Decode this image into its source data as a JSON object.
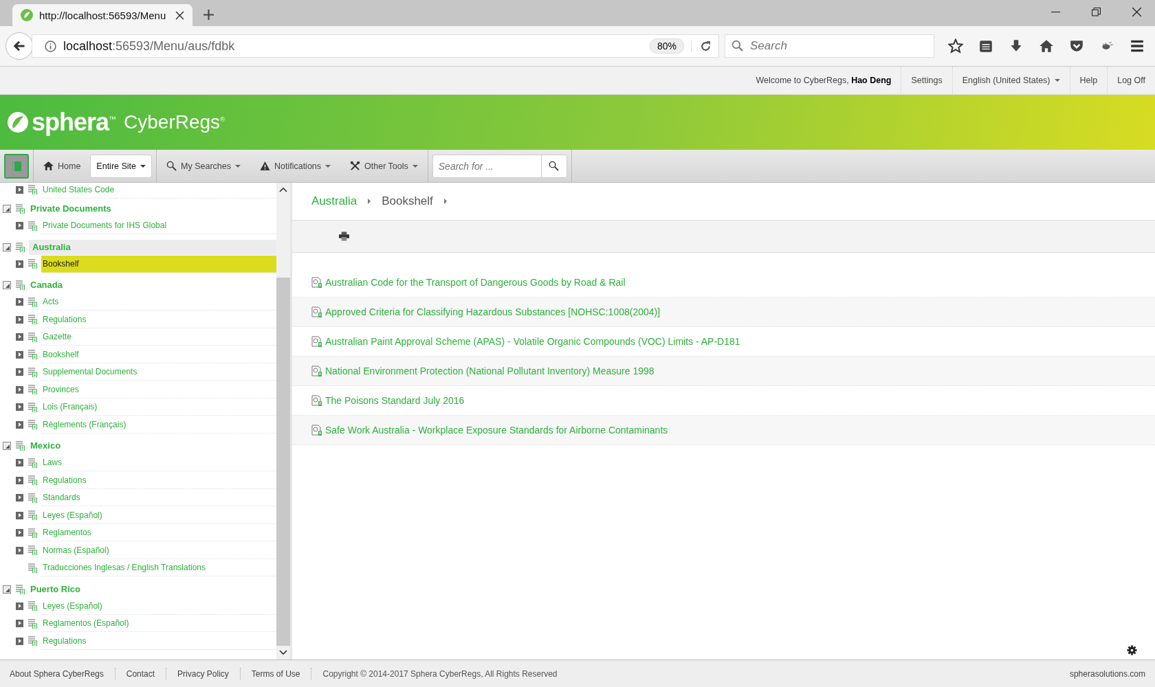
{
  "browser": {
    "tab_title": "http://localhost:56593/Menu",
    "url_host": "localhost",
    "url_path": ":56593/Menu/aus/fdbk",
    "zoom": "80%",
    "search_placeholder": "Search"
  },
  "top_bar": {
    "welcome": "Welcome to CyberRegs, **Hao Deng**",
    "links": [
      {
        "label": "Settings",
        "kind": "link"
      },
      {
        "label": "English (United States)",
        "kind": "dropdown"
      },
      {
        "label": "Help",
        "kind": "link"
      },
      {
        "label": "Log Off",
        "kind": "link"
      }
    ]
  },
  "banner": {
    "brand": "sphera$^{™}$",
    "product": "CyberRegs$^{®}$"
  },
  "toolbar": {
    "items": [
      {
        "label": "Home",
        "kind": "home"
      },
      {
        "label": "Entire Site",
        "kind": "scope"
      },
      {
        "label": "My Searches",
        "kind": "searches"
      },
      {
        "label": "Notifications",
        "kind": "notifications"
      },
      {
        "label": "Other Tools",
        "kind": "tools"
      }
    ],
    "search_placeholder": "Search for ..."
  },
  "tree": {
    "leading_items": [
      {
        "label": "United States Code",
        "expandable": true,
        "selected": false
      }
    ],
    "groups": [
      {
        "label": "Private Documents",
        "expanded": true,
        "selected": false,
        "children": [
          {
            "label": "Private Documents for IHS Global",
            "expandable": true,
            "selected": false
          }
        ]
      },
      {
        "label": "Australia",
        "expanded": true,
        "selected": true,
        "children": [
          {
            "label": "Bookshelf",
            "expandable": true,
            "selected": true
          }
        ]
      },
      {
        "label": "Canada",
        "expanded": true,
        "selected": false,
        "children": [
          {
            "label": "Acts",
            "expandable": true,
            "selected": false
          },
          {
            "label": "Regulations",
            "expandable": true,
            "selected": false
          },
          {
            "label": "Gazette",
            "expandable": true,
            "selected": false
          },
          {
            "label": "Bookshelf",
            "expandable": true,
            "selected": false
          },
          {
            "label": "Supplemental Documents",
            "expandable": true,
            "selected": false
          },
          {
            "label": "Provinces",
            "expandable": true,
            "selected": false
          },
          {
            "label": "Lois (Français)",
            "expandable": true,
            "selected": false
          },
          {
            "label": "Règlements (Français)",
            "expandable": true,
            "selected": false
          }
        ]
      },
      {
        "label": "Mexico",
        "expanded": true,
        "selected": false,
        "children": [
          {
            "label": "Laws",
            "expandable": true,
            "selected": false
          },
          {
            "label": "Regulations",
            "expandable": true,
            "selected": false
          },
          {
            "label": "Standards",
            "expandable": true,
            "selected": false
          },
          {
            "label": "Leyes (Español)",
            "expandable": true,
            "selected": false
          },
          {
            "label": "Reglamentos",
            "expandable": true,
            "selected": false
          },
          {
            "label": "Normas (Español)",
            "expandable": true,
            "selected": false
          },
          {
            "label": "Traducciones Inglesas / English Translations",
            "expandable": false,
            "selected": false
          }
        ]
      },
      {
        "label": "Puerto Rico",
        "expanded": true,
        "selected": false,
        "children": [
          {
            "label": "Leyes (Español)",
            "expandable": true,
            "selected": false
          },
          {
            "label": "Reglamentos (Español)",
            "expandable": true,
            "selected": false
          },
          {
            "label": "Regulations",
            "expandable": true,
            "selected": false
          }
        ]
      }
    ]
  },
  "breadcrumb": [
    {
      "label": "Australia",
      "kind": "link"
    },
    {
      "label": "Bookshelf",
      "kind": "current"
    }
  ],
  "documents": [
    "Australian Code for the Transport of Dangerous Goods by Road & Rail",
    "Approved Criteria for Classifying Hazardous Substances [NOHSC:1008(2004)]",
    "Australian Paint Approval Scheme (APAS) - Volatile Organic Compounds (VOC) Limits - AP-D181",
    "National Environment Protection (National Pollutant Inventory) Measure 1998",
    "The Poisons Standard July 2016",
    "Safe Work Australia - Workplace Exposure Standards for Airborne Contaminants"
  ],
  "footer": {
    "links": [
      "About Sphera CyberRegs",
      "Contact",
      "Privacy Policy",
      "Terms of Use"
    ],
    "copyright": "Copyright © 2014-2017 Sphera CyberRegs, All Rights Reserved",
    "site": "spherasolutions.com"
  }
}
